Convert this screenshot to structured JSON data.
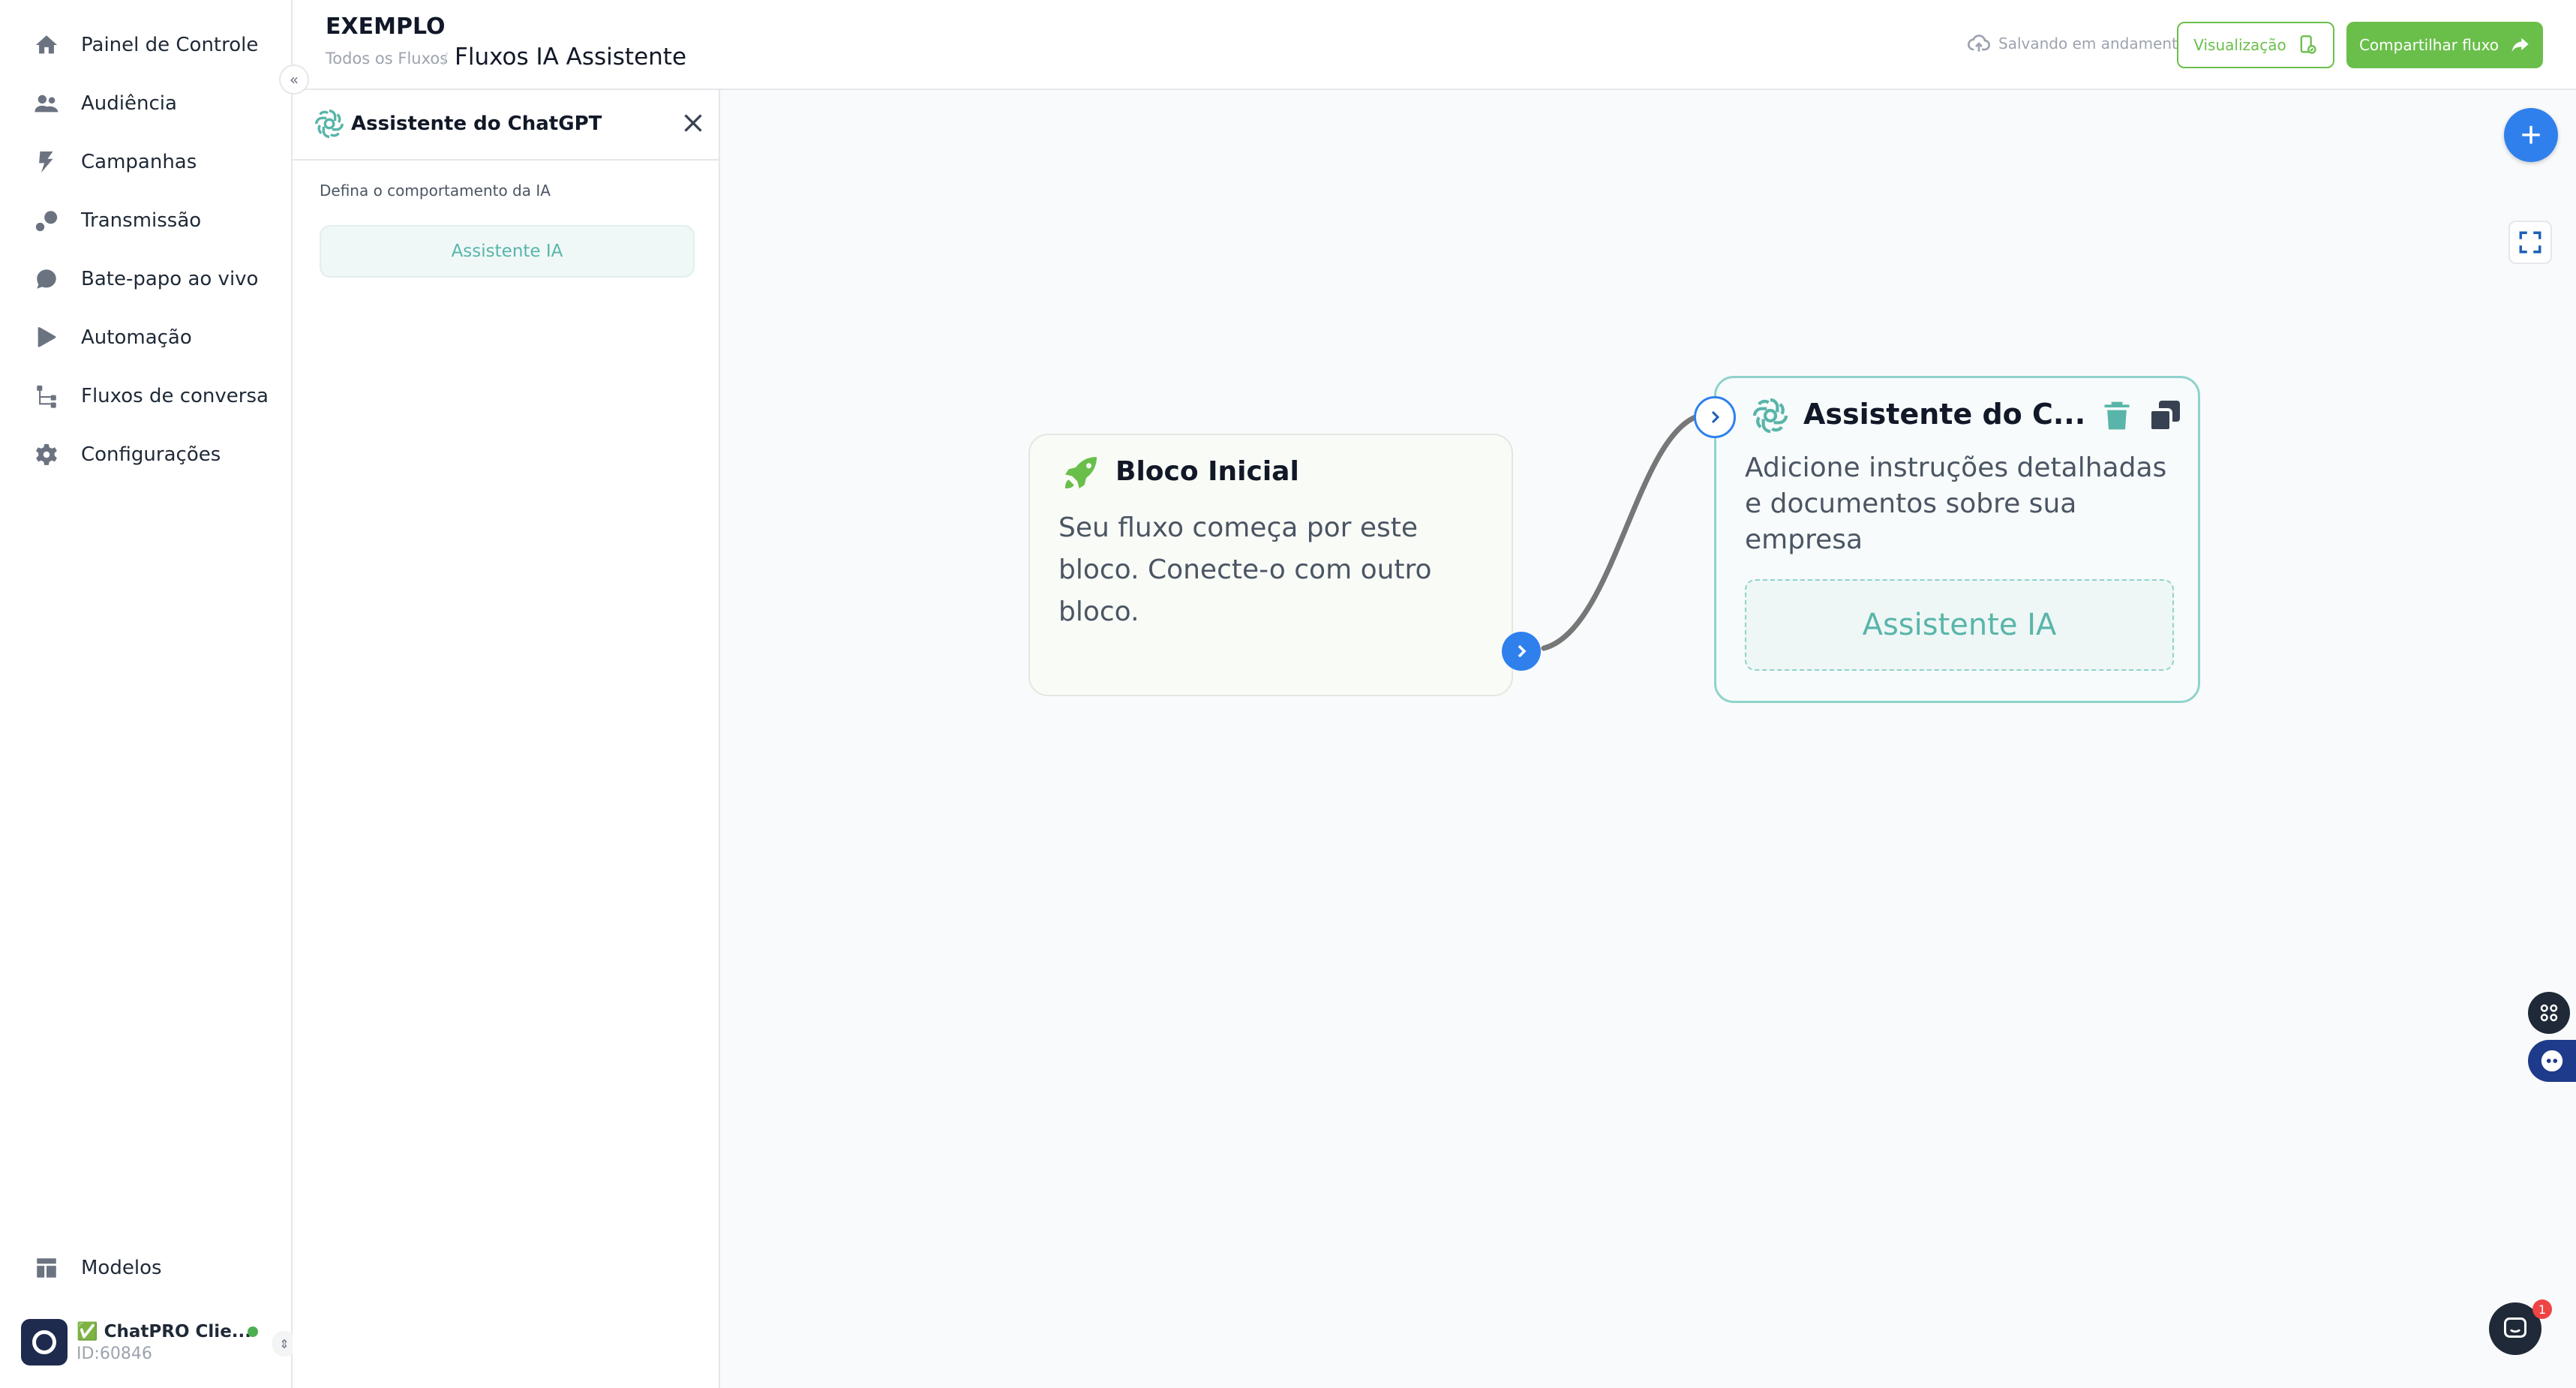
{
  "sidebar": {
    "items": [
      {
        "label": "Painel de Controle",
        "icon": "home-icon"
      },
      {
        "label": "Audiência",
        "icon": "users-icon"
      },
      {
        "label": "Campanhas",
        "icon": "bolt-icon"
      },
      {
        "label": "Transmissão",
        "icon": "broadcast-icon"
      },
      {
        "label": "Bate-papo ao vivo",
        "icon": "chat-bubble-icon"
      },
      {
        "label": "Automação",
        "icon": "play-icon"
      },
      {
        "label": "Fluxos de conversa",
        "icon": "flow-icon"
      },
      {
        "label": "Configurações",
        "icon": "gear-icon"
      }
    ],
    "bottom_item": {
      "label": "Modelos",
      "icon": "templates-icon"
    },
    "collapse_glyph": "«",
    "account": {
      "name": "✅ ChatPRO Clie...",
      "id": "ID:60846",
      "status_color": "#4caf50"
    }
  },
  "header": {
    "title": "EXEMPLO",
    "breadcrumb_root": "Todos os Fluxos",
    "breadcrumb_sep": "/",
    "flow_name": "Fluxos IA Assistente",
    "saving_status": "Salvando em andamento",
    "preview_label": "Visualização",
    "share_label": "Compartilhar fluxo"
  },
  "panel": {
    "title": "Assistente do ChatGPT",
    "label": "Defina o comportamento da IA",
    "button": "Assistente IA"
  },
  "canvas": {
    "start_node": {
      "title": "Bloco Inicial",
      "description": "Seu fluxo começa por este bloco. Conecte-o com outro bloco."
    },
    "ai_node": {
      "title": "Assistente do C...",
      "description": "Adicione instruções detalhadas e documentos sobre sua empresa",
      "button": "Assistente IA"
    },
    "add_glyph": "+"
  },
  "chat": {
    "badge_count": "1"
  },
  "colors": {
    "accent_green": "#6abf4b",
    "accent_blue": "#2f80ed",
    "teal": "#59b5a9"
  }
}
